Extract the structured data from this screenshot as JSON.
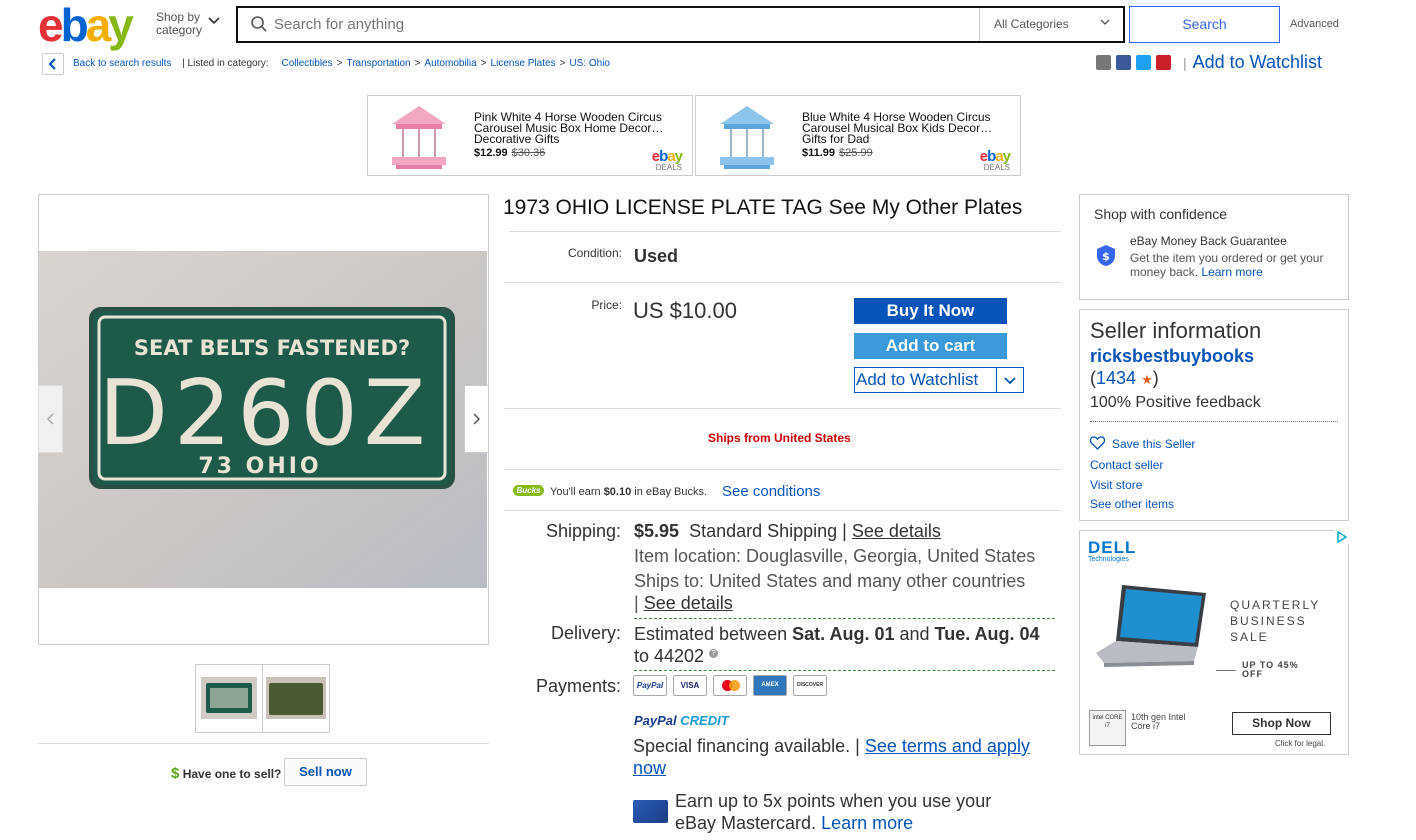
{
  "header": {
    "logo": {
      "e": "e",
      "b": "b",
      "a": "a",
      "y": "y"
    },
    "shop_by": "Shop by category",
    "search_placeholder": "Search for anything",
    "category": "All Categories",
    "search_button": "Search",
    "advanced": "Advanced"
  },
  "breadcrumb": {
    "back": "Back to search results",
    "listed_in": "| Listed in category:",
    "items": [
      "Collectibles",
      "Transportation",
      "Automobilia",
      "License Plates",
      "US: Ohio"
    ],
    "add_to_watchlist": "Add to Watchlist",
    "share_icons": [
      "email-icon",
      "facebook-icon",
      "twitter-icon",
      "pinterest-icon"
    ]
  },
  "deals": [
    {
      "title": "Pink White 4 Horse Wooden Circus Carousel Music Box Home Decor… Decorative Gifts",
      "price": "$12.99",
      "old_price": "$30.36",
      "brand": "ebay",
      "brand_sub": "DEALS",
      "color": "#f2a7c3"
    },
    {
      "title": "Blue White 4 Horse Wooden Circus Carousel Musical Box Kids Decor… Gifts for Dad",
      "price": "$11.99",
      "old_price": "$25.99",
      "brand": "ebay",
      "brand_sub": "DEALS",
      "color": "#8cc4ec"
    }
  ],
  "gallery": {
    "plate": {
      "top": "SEAT BELTS FASTENED?",
      "number": "D260Z",
      "bottom": "73 OHIO"
    }
  },
  "item": {
    "title": "1973 OHIO LICENSE PLATE TAG See My Other Plates",
    "condition_label": "Condition:",
    "condition": "Used",
    "price_label": "Price:",
    "price": "US $10.00",
    "buy_now": "Buy It Now",
    "add_to_cart": "Add to cart",
    "add_to_watchlist": "Add to Watchlist",
    "ships_from": "Ships from United States",
    "bucks_badge": "Bucks",
    "bucks_text_pre": "You'll earn",
    "bucks_amount": "$0.10",
    "bucks_text_post": "in eBay Bucks.",
    "see_conditions": "See conditions",
    "shipping_label": "Shipping:",
    "shipping_price": "$5.95",
    "shipping_method": "Standard Shipping |",
    "see_details": "See details",
    "item_location": "Item location: Douglasville, Georgia, United States",
    "ships_to": "Ships to: United States and many other countries",
    "see_details_2": "See details",
    "delivery_label": "Delivery:",
    "delivery_pre": "Estimated between",
    "delivery_start": "Sat. Aug. 01",
    "delivery_and": "and",
    "delivery_end": "Tue. Aug. 04",
    "delivery_to": "to 44202",
    "payments_label": "Payments:",
    "payment_methods": [
      "PayPal",
      "VISA",
      "MC",
      "AMEX",
      "DISCOVER"
    ],
    "paypal_credit_a": "PayPal",
    "paypal_credit_b": "CREDIT",
    "financing_text": "Special financing available.  |",
    "financing_link": "See terms and apply now",
    "earn_text": "Earn up to 5x points when you use your eBay Mastercard.",
    "learn_more": "Learn more"
  },
  "sell": {
    "have_one": "Have one to sell?",
    "dollar": "$",
    "sell_now": "Sell now"
  },
  "confidence": {
    "title": "Shop with confidence",
    "mbg_title": "eBay Money Back Guarantee",
    "mbg_desc": "Get the item you ordered or get your money back.",
    "learn_more": "Learn more"
  },
  "seller": {
    "heading": "Seller information",
    "name": "ricksbestbuybooks",
    "score": "1434",
    "feedback": "100% Positive feedback",
    "save": "Save this Seller",
    "contact": "Contact seller",
    "visit_store": "Visit store",
    "other_items": "See other items"
  },
  "ad": {
    "brand": "DELL",
    "brand_sub": "Technologies",
    "headline": "QUARTERLY BUSINESS SALE",
    "offer": "UP TO 45% OFF",
    "intel_badge": "intel CORE i7",
    "intel_text": "10th gen Intel Core i7",
    "shop_now": "Shop Now",
    "legal": "Click for legal."
  },
  "colors": {
    "ebay_red": "#e53238",
    "ebay_blue": "#0064d2",
    "ebay_yellow": "#f5af02",
    "ebay_green": "#86b817",
    "link": "#0654ba",
    "buy_button": "#0654ba",
    "cart_button": "#3a9ad9",
    "ships_from": "#cc0000"
  }
}
